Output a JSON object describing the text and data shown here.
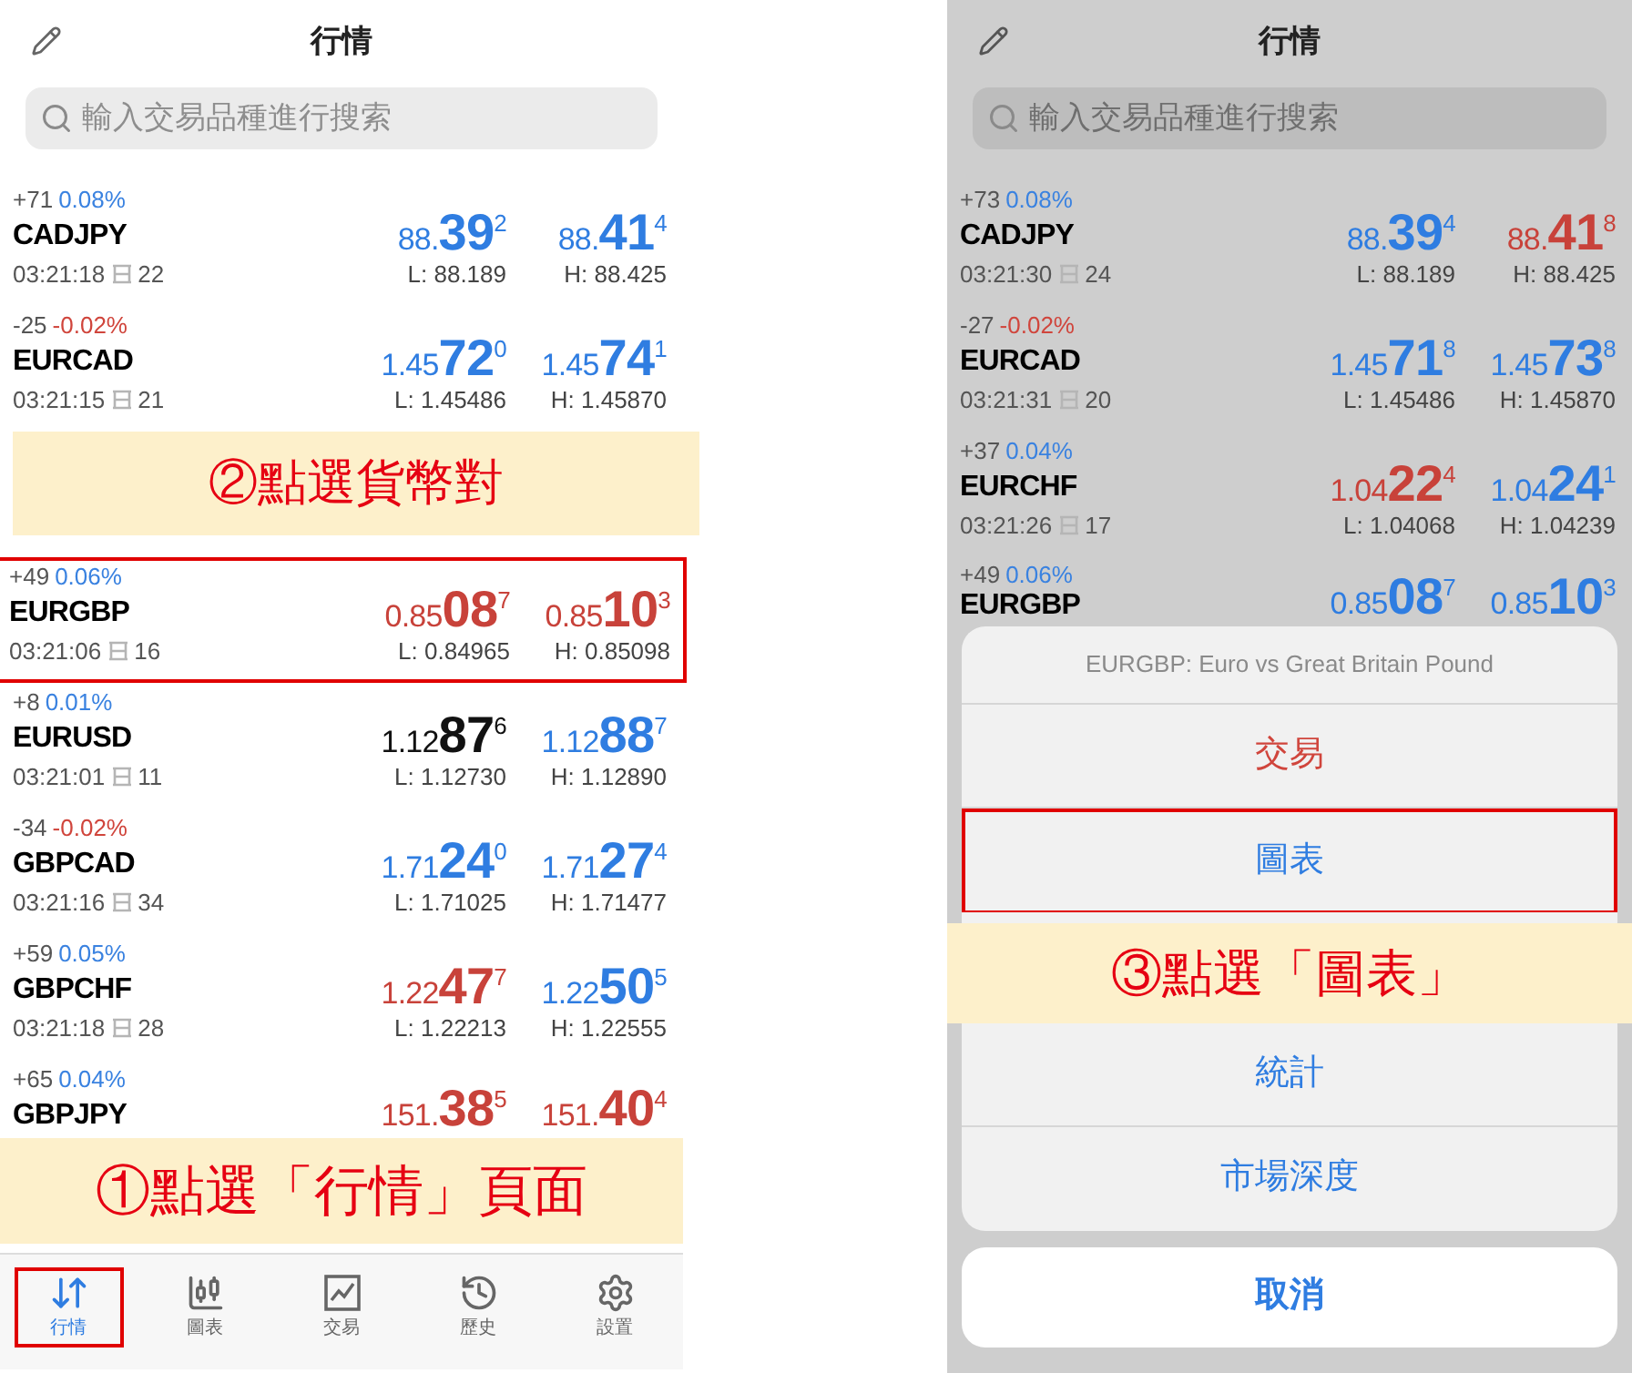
{
  "left_screen": {
    "header": {
      "title": "行情"
    },
    "search": {
      "placeholder": "輸入交易品種進行搜索"
    },
    "quotes": [
      {
        "change": "+71",
        "percent": {
          "text": "0.08%",
          "color": "#3a82e0"
        },
        "symbol": "CADJPY",
        "time": "03:21:18",
        "spread": "22",
        "bid": {
          "prefix": "88.",
          "big": "39",
          "sup": "2",
          "color": "#2f7de1"
        },
        "ask": {
          "prefix": "88.",
          "big": "41",
          "sup": "4",
          "color": "#2f7de1"
        },
        "low": "L: 88.189",
        "high": "H: 88.425",
        "highlighted": false
      },
      {
        "change": "-25",
        "percent": {
          "text": "-0.02%",
          "color": "#d0453c"
        },
        "symbol": "EURCAD",
        "time": "03:21:15",
        "spread": "21",
        "bid": {
          "prefix": "1.45",
          "big": "72",
          "sup": "0",
          "color": "#2f7de1"
        },
        "ask": {
          "prefix": "1.45",
          "big": "74",
          "sup": "1",
          "color": "#2f7de1"
        },
        "low": "L: 1.45486",
        "high": "H: 1.45870",
        "highlighted": false
      },
      {
        "change": "+49",
        "percent": {
          "text": "0.06%",
          "color": "#3a82e0"
        },
        "symbol": "EURGBP",
        "time": "03:21:06",
        "spread": "16",
        "bid": {
          "prefix": "0.85",
          "big": "08",
          "sup": "7",
          "color": "#c8423a"
        },
        "ask": {
          "prefix": "0.85",
          "big": "10",
          "sup": "3",
          "color": "#c8423a"
        },
        "low": "L: 0.84965",
        "high": "H: 0.85098",
        "highlighted": true
      },
      {
        "change": "+8",
        "percent": {
          "text": "0.01%",
          "color": "#3a82e0"
        },
        "symbol": "EURUSD",
        "time": "03:21:01",
        "spread": "11",
        "bid": {
          "prefix": "1.12",
          "big": "87",
          "sup": "6",
          "color": "#111111"
        },
        "ask": {
          "prefix": "1.12",
          "big": "88",
          "sup": "7",
          "color": "#2f7de1"
        },
        "low": "L: 1.12730",
        "high": "H: 1.12890",
        "highlighted": false
      },
      {
        "change": "-34",
        "percent": {
          "text": "-0.02%",
          "color": "#d0453c"
        },
        "symbol": "GBPCAD",
        "time": "03:21:16",
        "spread": "34",
        "bid": {
          "prefix": "1.71",
          "big": "24",
          "sup": "0",
          "color": "#2f7de1"
        },
        "ask": {
          "prefix": "1.71",
          "big": "27",
          "sup": "4",
          "color": "#2f7de1"
        },
        "low": "L: 1.71025",
        "high": "H: 1.71477",
        "highlighted": false
      },
      {
        "change": "+59",
        "percent": {
          "text": "0.05%",
          "color": "#3a82e0"
        },
        "symbol": "GBPCHF",
        "time": "03:21:18",
        "spread": "28",
        "bid": {
          "prefix": "1.22",
          "big": "47",
          "sup": "7",
          "color": "#c8423a"
        },
        "ask": {
          "prefix": "1.22",
          "big": "50",
          "sup": "5",
          "color": "#2f7de1"
        },
        "low": "L: 1.22213",
        "high": "H: 1.22555",
        "highlighted": false
      },
      {
        "change": "+65",
        "percent": {
          "text": "0.04%",
          "color": "#3a82e0"
        },
        "symbol": "GBPJPY",
        "bid": {
          "prefix": "151.",
          "big": "38",
          "sup": "5",
          "color": "#c8423a"
        },
        "ask": {
          "prefix": "151.",
          "big": "40",
          "sup": "4",
          "color": "#c8423a"
        },
        "highlighted": false
      }
    ],
    "tab_bar": [
      {
        "kind": "quotes",
        "label": "行情",
        "selected": true,
        "highlighted": true
      },
      {
        "kind": "chart",
        "label": "圖表",
        "selected": false,
        "highlighted": false
      },
      {
        "kind": "trade",
        "label": "交易",
        "selected": false,
        "highlighted": false
      },
      {
        "kind": "history",
        "label": "歷史",
        "selected": false,
        "highlighted": false
      },
      {
        "kind": "settings",
        "label": "設置",
        "selected": false,
        "highlighted": false
      }
    ]
  },
  "right_screen": {
    "header": {
      "title": "行情"
    },
    "search": {
      "placeholder": "輸入交易品種進行搜索"
    },
    "quotes": [
      {
        "change": "+73",
        "percent": {
          "text": "0.08%",
          "color": "#3a82e0"
        },
        "symbol": "CADJPY",
        "time": "03:21:30",
        "spread": "24",
        "bid": {
          "prefix": "88.",
          "big": "39",
          "sup": "4",
          "color": "#2f7de1"
        },
        "ask": {
          "prefix": "88.",
          "big": "41",
          "sup": "8",
          "color": "#c8423a"
        },
        "low": "L: 88.189",
        "high": "H: 88.425",
        "highlighted": false
      },
      {
        "change": "-27",
        "percent": {
          "text": "-0.02%",
          "color": "#d0453c"
        },
        "symbol": "EURCAD",
        "time": "03:21:31",
        "spread": "20",
        "bid": {
          "prefix": "1.45",
          "big": "71",
          "sup": "8",
          "color": "#2f7de1"
        },
        "ask": {
          "prefix": "1.45",
          "big": "73",
          "sup": "8",
          "color": "#2f7de1"
        },
        "low": "L: 1.45486",
        "high": "H: 1.45870",
        "highlighted": false
      },
      {
        "change": "+37",
        "percent": {
          "text": "0.04%",
          "color": "#3a82e0"
        },
        "symbol": "EURCHF",
        "time": "03:21:26",
        "spread": "17",
        "bid": {
          "prefix": "1.04",
          "big": "22",
          "sup": "4",
          "color": "#c8423a"
        },
        "ask": {
          "prefix": "1.04",
          "big": "24",
          "sup": "1",
          "color": "#2f7de1"
        },
        "low": "L: 1.04068",
        "high": "H: 1.04239",
        "highlighted": false
      },
      {
        "change": "+49",
        "percent": {
          "text": "0.06%",
          "color": "#3a82e0"
        },
        "symbol": "EURGBP",
        "bid": {
          "prefix": "0.85",
          "big": "08",
          "sup": "7",
          "color": "#2f7de1"
        },
        "ask": {
          "prefix": "0.85",
          "big": "10",
          "sup": "3",
          "color": "#2f7de1"
        },
        "highlighted": false
      }
    ],
    "action_sheet": {
      "title": "EURGBP: Euro vs Great Britain Pound",
      "items": [
        {
          "label": "交易",
          "color": "#d0453c",
          "highlighted": false
        },
        {
          "label": "圖表",
          "color": "#2f7de1",
          "highlighted": true
        },
        {
          "label": "統計",
          "color": "#2f7de1",
          "highlighted": false
        },
        {
          "label": "市場深度",
          "color": "#2f7de1",
          "highlighted": false
        }
      ],
      "cancel": "取消"
    }
  },
  "annotations": [
    {
      "text": "②點選貨幣對"
    },
    {
      "text": "①點選「行情」頁面"
    },
    {
      "text": "③點選「圖表」"
    }
  ]
}
